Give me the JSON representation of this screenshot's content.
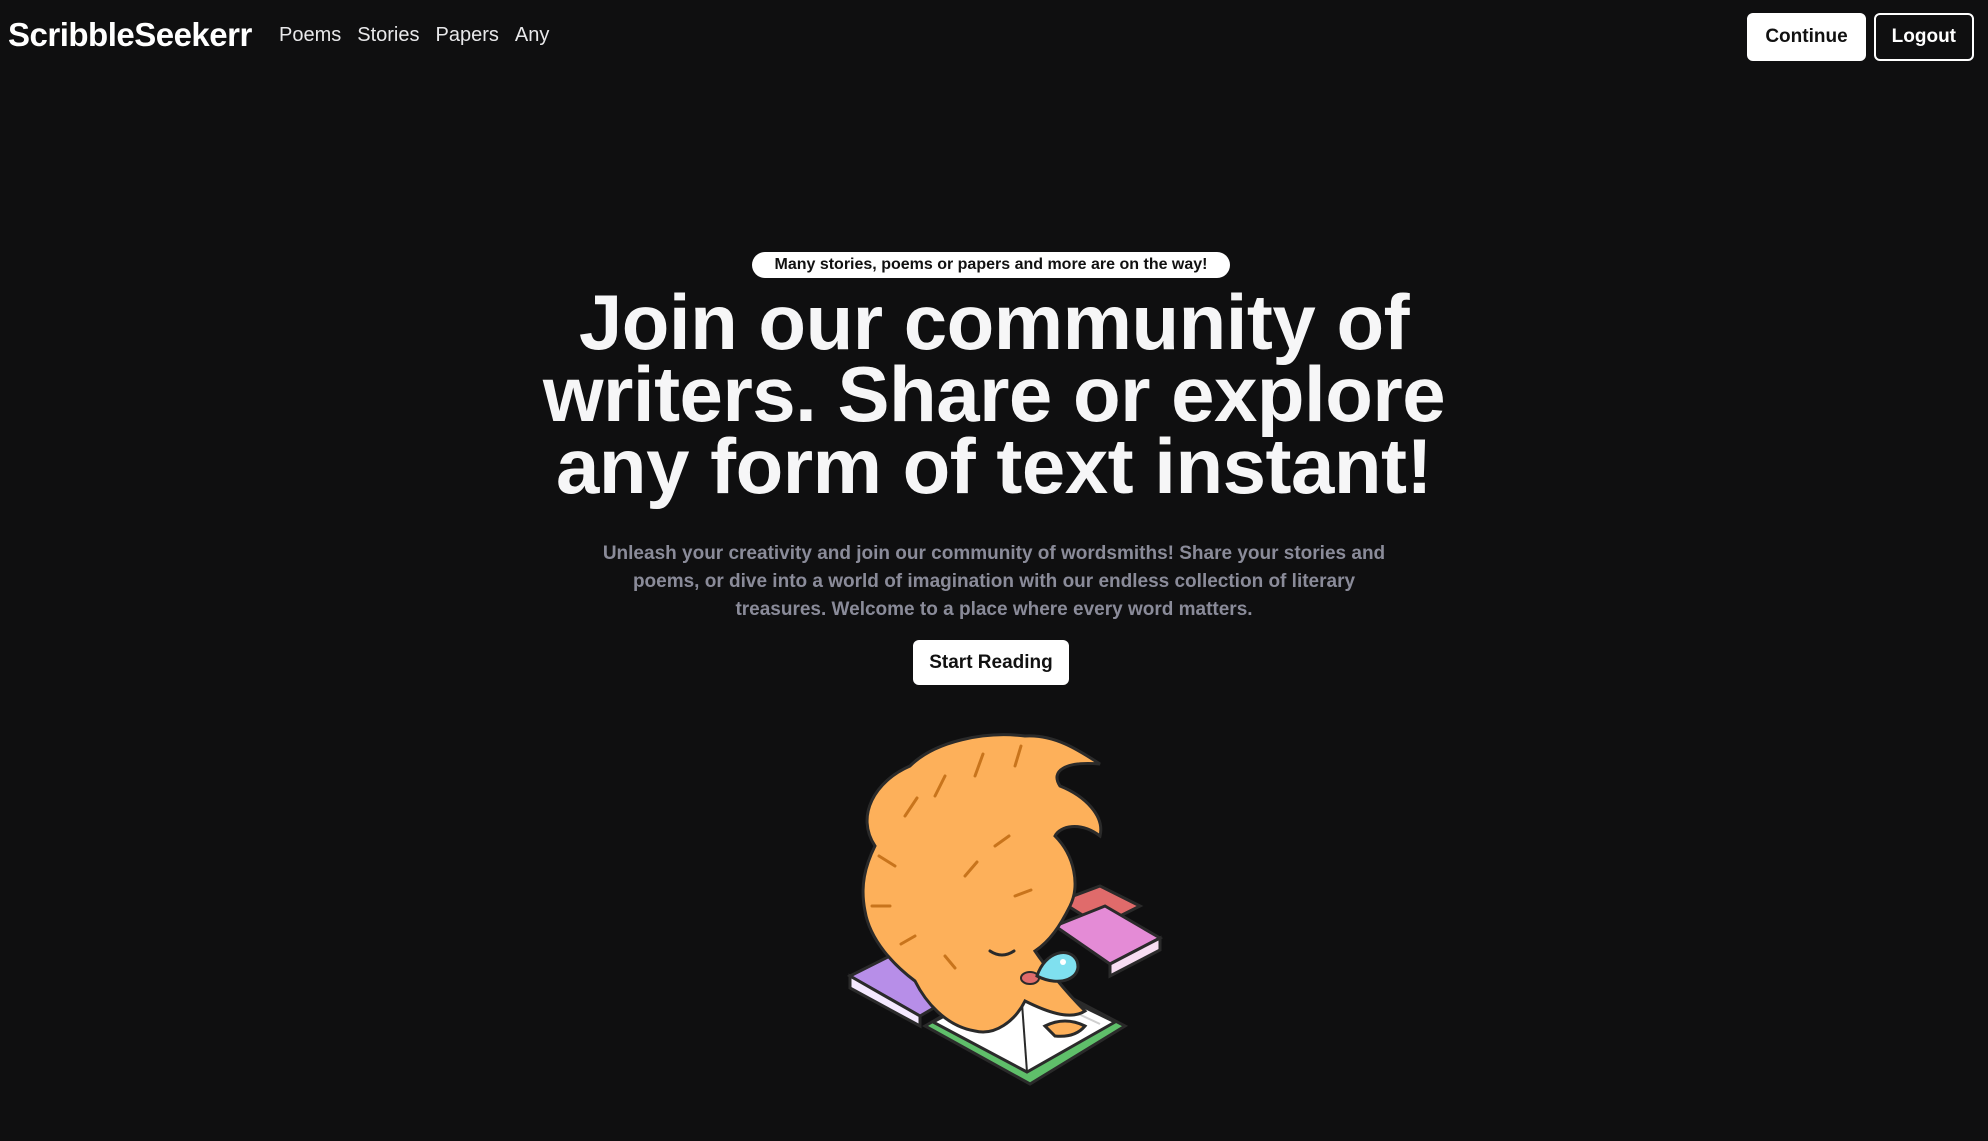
{
  "header": {
    "brand": "ScribbleSeekerr",
    "nav": [
      "Poems",
      "Stories",
      "Papers",
      "Any"
    ],
    "continue_label": "Continue",
    "logout_label": "Logout"
  },
  "hero": {
    "badge": "Many stories, poems or papers and more are on the way!",
    "headline_lines": [
      "Join our community of",
      "writers. Share or explore",
      "any form of text instant!"
    ],
    "description_lines": [
      "Unleash your creativity and join our community of wordsmiths! Share your stories and",
      "poems, or dive into a world of imagination with our endless collection of literary",
      "treasures. Welcome to a place where every word matters."
    ],
    "cta_label": "Start Reading",
    "illustration_icon": "sleeping-dog-on-books-illustration"
  },
  "colors": {
    "background": "#0f0f10",
    "text": "#f4f4f5",
    "muted": "#8a8b99",
    "dog_fur": "#fdb05a",
    "book_purple": "#b78ee8",
    "book_pink": "#e48bd6",
    "book_red": "#e06b6b",
    "book_green": "#5fbf6a",
    "bubble": "#7fe0ef"
  }
}
